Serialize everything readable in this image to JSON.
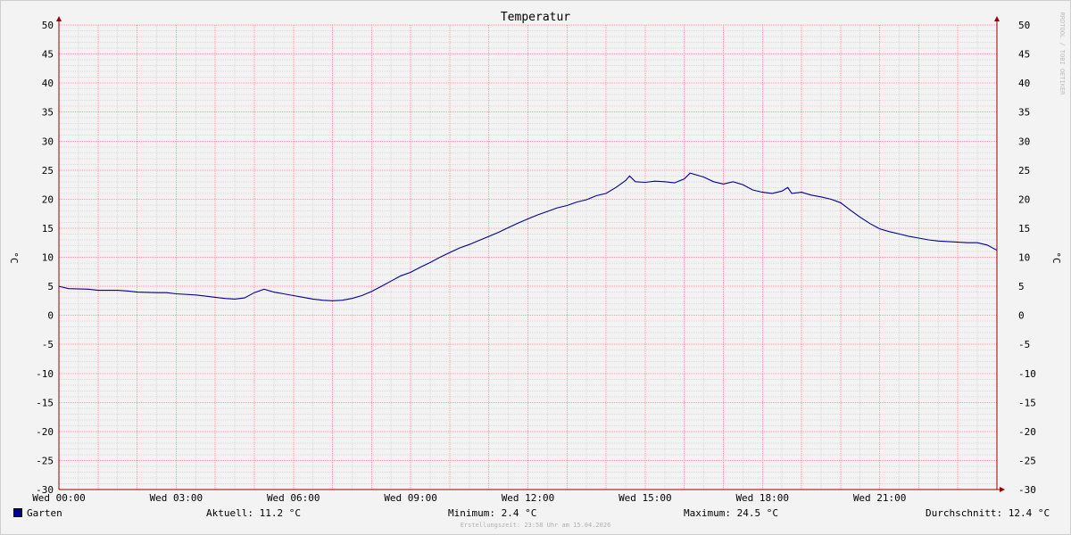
{
  "watermark": "RRDTOOL / TOBI OETIKER",
  "legend": {
    "series_label": "Garten",
    "current": "Aktuell: 11.2 °C",
    "minimum": "Minimum: 2.4 °C",
    "maximum": "Maximum: 24.5 °C",
    "average": "Durchschnitt: 12.4 °C"
  },
  "footer": "Erstellungszeit: 23:58 Uhr am 15.04.2026",
  "colors": {
    "line": "#000099",
    "grid_minor": "#d9d9d9",
    "grid_major": "#f2a0a0",
    "axis": "#990000"
  },
  "chart_data": {
    "type": "line",
    "title": "Temperatur",
    "ylabel": "°C",
    "ylim": [
      -30,
      50
    ],
    "yticks": [
      50,
      45,
      40,
      35,
      30,
      25,
      20,
      15,
      10,
      5,
      0,
      -5,
      -10,
      -15,
      -20,
      -25,
      -30
    ],
    "xlim": [
      0,
      24
    ],
    "xticks": [
      {
        "x": 0,
        "label": "Wed 00:00"
      },
      {
        "x": 3,
        "label": "Wed 03:00"
      },
      {
        "x": 6,
        "label": "Wed 06:00"
      },
      {
        "x": 9,
        "label": "Wed 09:00"
      },
      {
        "x": 12,
        "label": "Wed 12:00"
      },
      {
        "x": 15,
        "label": "Wed 15:00"
      },
      {
        "x": 18,
        "label": "Wed 18:00"
      },
      {
        "x": 21,
        "label": "Wed 21:00"
      }
    ],
    "grid": true,
    "legend_position": "bottom-left",
    "series": [
      {
        "name": "Garten",
        "points": [
          [
            0,
            5.0
          ],
          [
            0.25,
            4.6
          ],
          [
            0.75,
            4.5
          ],
          [
            1.0,
            4.3
          ],
          [
            1.5,
            4.3
          ],
          [
            1.75,
            4.2
          ],
          [
            2.0,
            4.0
          ],
          [
            2.5,
            3.9
          ],
          [
            2.75,
            3.9
          ],
          [
            3.0,
            3.7
          ],
          [
            3.5,
            3.5
          ],
          [
            3.75,
            3.3
          ],
          [
            4.0,
            3.1
          ],
          [
            4.25,
            2.9
          ],
          [
            4.5,
            2.8
          ],
          [
            4.75,
            3.0
          ],
          [
            5.0,
            3.9
          ],
          [
            5.25,
            4.5
          ],
          [
            5.5,
            4.0
          ],
          [
            5.75,
            3.7
          ],
          [
            6.0,
            3.4
          ],
          [
            6.25,
            3.1
          ],
          [
            6.5,
            2.8
          ],
          [
            6.75,
            2.6
          ],
          [
            7.0,
            2.5
          ],
          [
            7.25,
            2.6
          ],
          [
            7.5,
            2.9
          ],
          [
            7.75,
            3.4
          ],
          [
            8.0,
            4.1
          ],
          [
            8.25,
            5.0
          ],
          [
            8.5,
            5.9
          ],
          [
            8.75,
            6.8
          ],
          [
            9.0,
            7.4
          ],
          [
            9.25,
            8.3
          ],
          [
            9.5,
            9.1
          ],
          [
            9.75,
            10.0
          ],
          [
            10.0,
            10.8
          ],
          [
            10.25,
            11.6
          ],
          [
            10.5,
            12.2
          ],
          [
            10.75,
            12.9
          ],
          [
            11.0,
            13.6
          ],
          [
            11.25,
            14.3
          ],
          [
            11.5,
            15.1
          ],
          [
            11.75,
            15.9
          ],
          [
            12.0,
            16.6
          ],
          [
            12.25,
            17.3
          ],
          [
            12.5,
            17.9
          ],
          [
            12.75,
            18.5
          ],
          [
            13.0,
            18.9
          ],
          [
            13.25,
            19.5
          ],
          [
            13.5,
            19.9
          ],
          [
            13.75,
            20.6
          ],
          [
            14.0,
            21.0
          ],
          [
            14.25,
            22.0
          ],
          [
            14.5,
            23.2
          ],
          [
            14.6,
            24.0
          ],
          [
            14.75,
            23.0
          ],
          [
            15.0,
            22.9
          ],
          [
            15.25,
            23.1
          ],
          [
            15.5,
            23.0
          ],
          [
            15.75,
            22.8
          ],
          [
            16.0,
            23.5
          ],
          [
            16.15,
            24.5
          ],
          [
            16.5,
            23.8
          ],
          [
            16.75,
            23.0
          ],
          [
            17.0,
            22.6
          ],
          [
            17.25,
            23.0
          ],
          [
            17.5,
            22.5
          ],
          [
            17.75,
            21.6
          ],
          [
            18.0,
            21.2
          ],
          [
            18.25,
            21.0
          ],
          [
            18.5,
            21.4
          ],
          [
            18.65,
            22.0
          ],
          [
            18.75,
            21.0
          ],
          [
            19.0,
            21.2
          ],
          [
            19.25,
            20.7
          ],
          [
            19.5,
            20.4
          ],
          [
            19.75,
            20.0
          ],
          [
            20.0,
            19.4
          ],
          [
            20.25,
            18.1
          ],
          [
            20.5,
            16.9
          ],
          [
            20.75,
            15.8
          ],
          [
            21.0,
            14.9
          ],
          [
            21.25,
            14.4
          ],
          [
            21.5,
            14.0
          ],
          [
            21.75,
            13.6
          ],
          [
            22.0,
            13.3
          ],
          [
            22.25,
            13.0
          ],
          [
            22.5,
            12.8
          ],
          [
            22.75,
            12.7
          ],
          [
            23.0,
            12.6
          ],
          [
            23.25,
            12.5
          ],
          [
            23.5,
            12.5
          ],
          [
            23.75,
            12.1
          ],
          [
            24.0,
            11.2
          ]
        ]
      }
    ]
  }
}
